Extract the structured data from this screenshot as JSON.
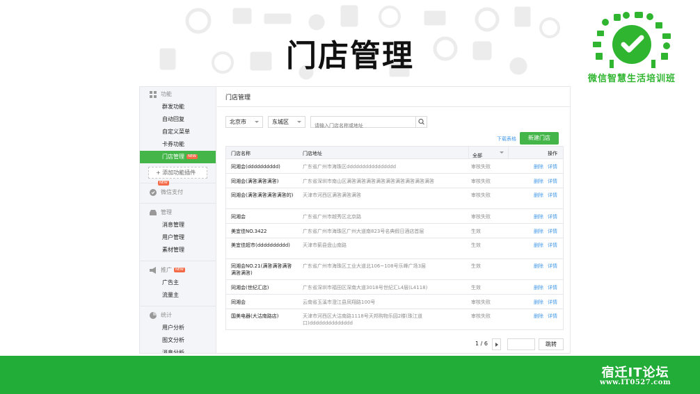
{
  "slide": {
    "title": "门店管理",
    "logo_caption": "微信智慧生活培训班",
    "forum_name": "宿迁IT论坛",
    "forum_url": "www.IT0527.com"
  },
  "colors": {
    "accent_green": "#44b549",
    "bottom_bar_green": "#22ac38",
    "link_blue": "#459ae9",
    "badge_orange": "#f56a46"
  },
  "sidebar": {
    "groups": [
      {
        "label": "功能",
        "icon": "grid-icon",
        "items": [
          "群发功能",
          "自动回复",
          "自定义菜单",
          "卡券功能",
          "门店管理"
        ]
      },
      {
        "label": "微信支付",
        "icon": "pay-icon",
        "items": []
      },
      {
        "label": "管理",
        "icon": "inbox-icon",
        "items": [
          "消息管理",
          "用户管理",
          "素材管理"
        ]
      },
      {
        "label": "推广",
        "icon": "megaphone-icon",
        "items": [
          "广告主",
          "流量主"
        ]
      },
      {
        "label": "统计",
        "icon": "pie-chart-icon",
        "items": [
          "用户分析",
          "图文分析",
          "消息分析"
        ]
      }
    ],
    "active_item": "门店管理",
    "new_badge": "NEW",
    "add_plugin_label": "添加功能插件"
  },
  "main": {
    "title": "门店管理",
    "filters": {
      "city": "北京市",
      "district": "东城区",
      "search_placeholder": "请输入门店名称或地址"
    },
    "download_link": "下载表格",
    "new_button": "新建门店",
    "table": {
      "headers": {
        "name": "门店名称",
        "address": "门店地址",
        "status": "全部",
        "action": "操作"
      },
      "rows": [
        {
          "name": "同湘会(dddddddddd)",
          "address": "广东省广州市海珠区dddddddddddddddd",
          "status": "审核失败"
        },
        {
          "name": "同湘会(满答满答满答)",
          "address": "广东省深圳市南山区满答满答满答满答满答满答满答满答满答",
          "status": "审核失败"
        },
        {
          "name": "同湘会(满答满答满答满答的)",
          "address": "天津市河西区满答满答满答",
          "status": "审核失败"
        },
        {
          "name": "同湘会",
          "address": "广东省广州市越秀区北京路",
          "status": "审核失败"
        },
        {
          "name": "美宜佳NO.3422",
          "address": "广东省广州市海珠区广州大道南823号名典假日酒店首层",
          "status": "生效"
        },
        {
          "name": "美宜佳超市(dddddddddd)",
          "address": "天津市蓟县盘山南路",
          "status": "生效"
        },
        {
          "name": "同湘会NO.21(满答满答满答满答满答)",
          "address": "广东省广州市海珠区工业大道北106~108号乐峰广场3层",
          "status": "生效"
        },
        {
          "name": "同湘会(世纪汇店)",
          "address": "广东省深圳市福田区深南大道3018号世纪汇L4层(L4118)",
          "status": "生效"
        },
        {
          "name": "同湘会",
          "address": "云南省玉溪市澄江县凤翔路100号",
          "status": "审核失败"
        },
        {
          "name": "国美电器(大沽南路店)",
          "address": "天津市河西区大沽南路1118号天邦购物乐园2楼(珠江道口)dddddddddddddd",
          "status": "审核失败"
        }
      ],
      "action_delete": "删除",
      "action_detail": "详情"
    },
    "pagination": {
      "text": "1 / 6",
      "jump_label": "跳转"
    }
  }
}
